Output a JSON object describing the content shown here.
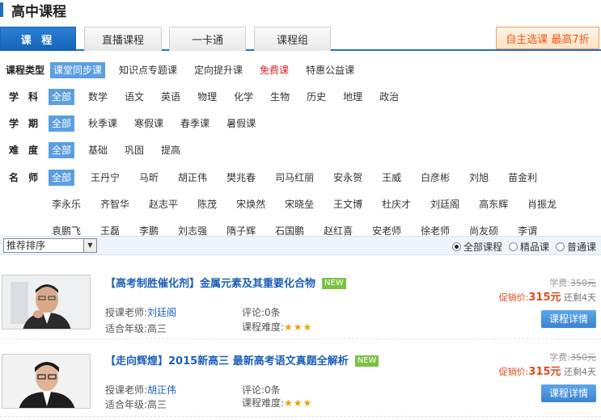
{
  "page_title": "高中课程",
  "tabs": [
    "课 程",
    "直播课程",
    "一卡通",
    "课程组"
  ],
  "promo_button": "自主选课 最高7折",
  "filters": {
    "type": {
      "label": "课程类型",
      "options": [
        "课堂同步课",
        "知识点专题课",
        "定向提升课",
        "免费课",
        "特惠公益课"
      ]
    },
    "subject": {
      "label": "学科",
      "options": [
        "全部",
        "数学",
        "语文",
        "英语",
        "物理",
        "化学",
        "生物",
        "历史",
        "地理",
        "政治"
      ]
    },
    "term": {
      "label": "学期",
      "options": [
        "全部",
        "秋季课",
        "寒假课",
        "春季课",
        "暑假课"
      ]
    },
    "difficulty": {
      "label": "难度",
      "options": [
        "全部",
        "基础",
        "巩固",
        "提高"
      ]
    },
    "teacher": {
      "label": "名师",
      "options": [
        "全部",
        "王丹宁",
        "马昕",
        "胡正伟",
        "樊兆春",
        "司马红丽",
        "安永贺",
        "王威",
        "白彦彬",
        "刘旭",
        "苗金利",
        "李永乐",
        "齐智华",
        "赵志平",
        "陈茂",
        "宋焕然",
        "宋晓垒",
        "王文博",
        "杜庆才",
        "刘廷阁",
        "高东辉",
        "肖振龙",
        "袁鹏飞",
        "王磊",
        "李鹏",
        "刘志强",
        "隋子辉",
        "石国鹏",
        "赵红喜",
        "安老师",
        "徐老师",
        "尚友硕",
        "李谓"
      ]
    }
  },
  "sort": {
    "selected": "推荐排序",
    "radios": [
      "全部课程",
      "精品课",
      "普通课"
    ]
  },
  "courses": [
    {
      "title": "【高考制胜催化剂】金属元素及其重要化合物",
      "badge": "NEW",
      "teacher_label": "授课老师:",
      "teacher": "刘廷阁",
      "grade_label": "适合年级:",
      "grade": "高三",
      "comments": "评论:0条",
      "difficulty_label": "课程难度:",
      "stars": "★★★",
      "fee_label": "学费:",
      "orig_price": "350元",
      "promo_label": "促销价:",
      "promo_price": "315元",
      "remain": "还剩4天",
      "detail": "课程详情"
    },
    {
      "title": "【走向辉煌】2015新高三 最新高考语文真题全解析",
      "badge": "NEW",
      "teacher_label": "授课老师:",
      "teacher": "胡正伟",
      "grade_label": "适合年级:",
      "grade": "高三",
      "comments": "评论:0条",
      "difficulty_label": "课程难度:",
      "stars": "★★★",
      "fee_label": "学费:",
      "orig_price": "350元",
      "promo_label": "促销价:",
      "promo_price": "315元",
      "remain": "还剩4天",
      "detail": "课程详情"
    }
  ],
  "colors": {
    "accent": "#1f6fc4",
    "selected_chip": "#5b9fe0",
    "price": "#e24b1a",
    "new_badge": "#7bc143"
  }
}
